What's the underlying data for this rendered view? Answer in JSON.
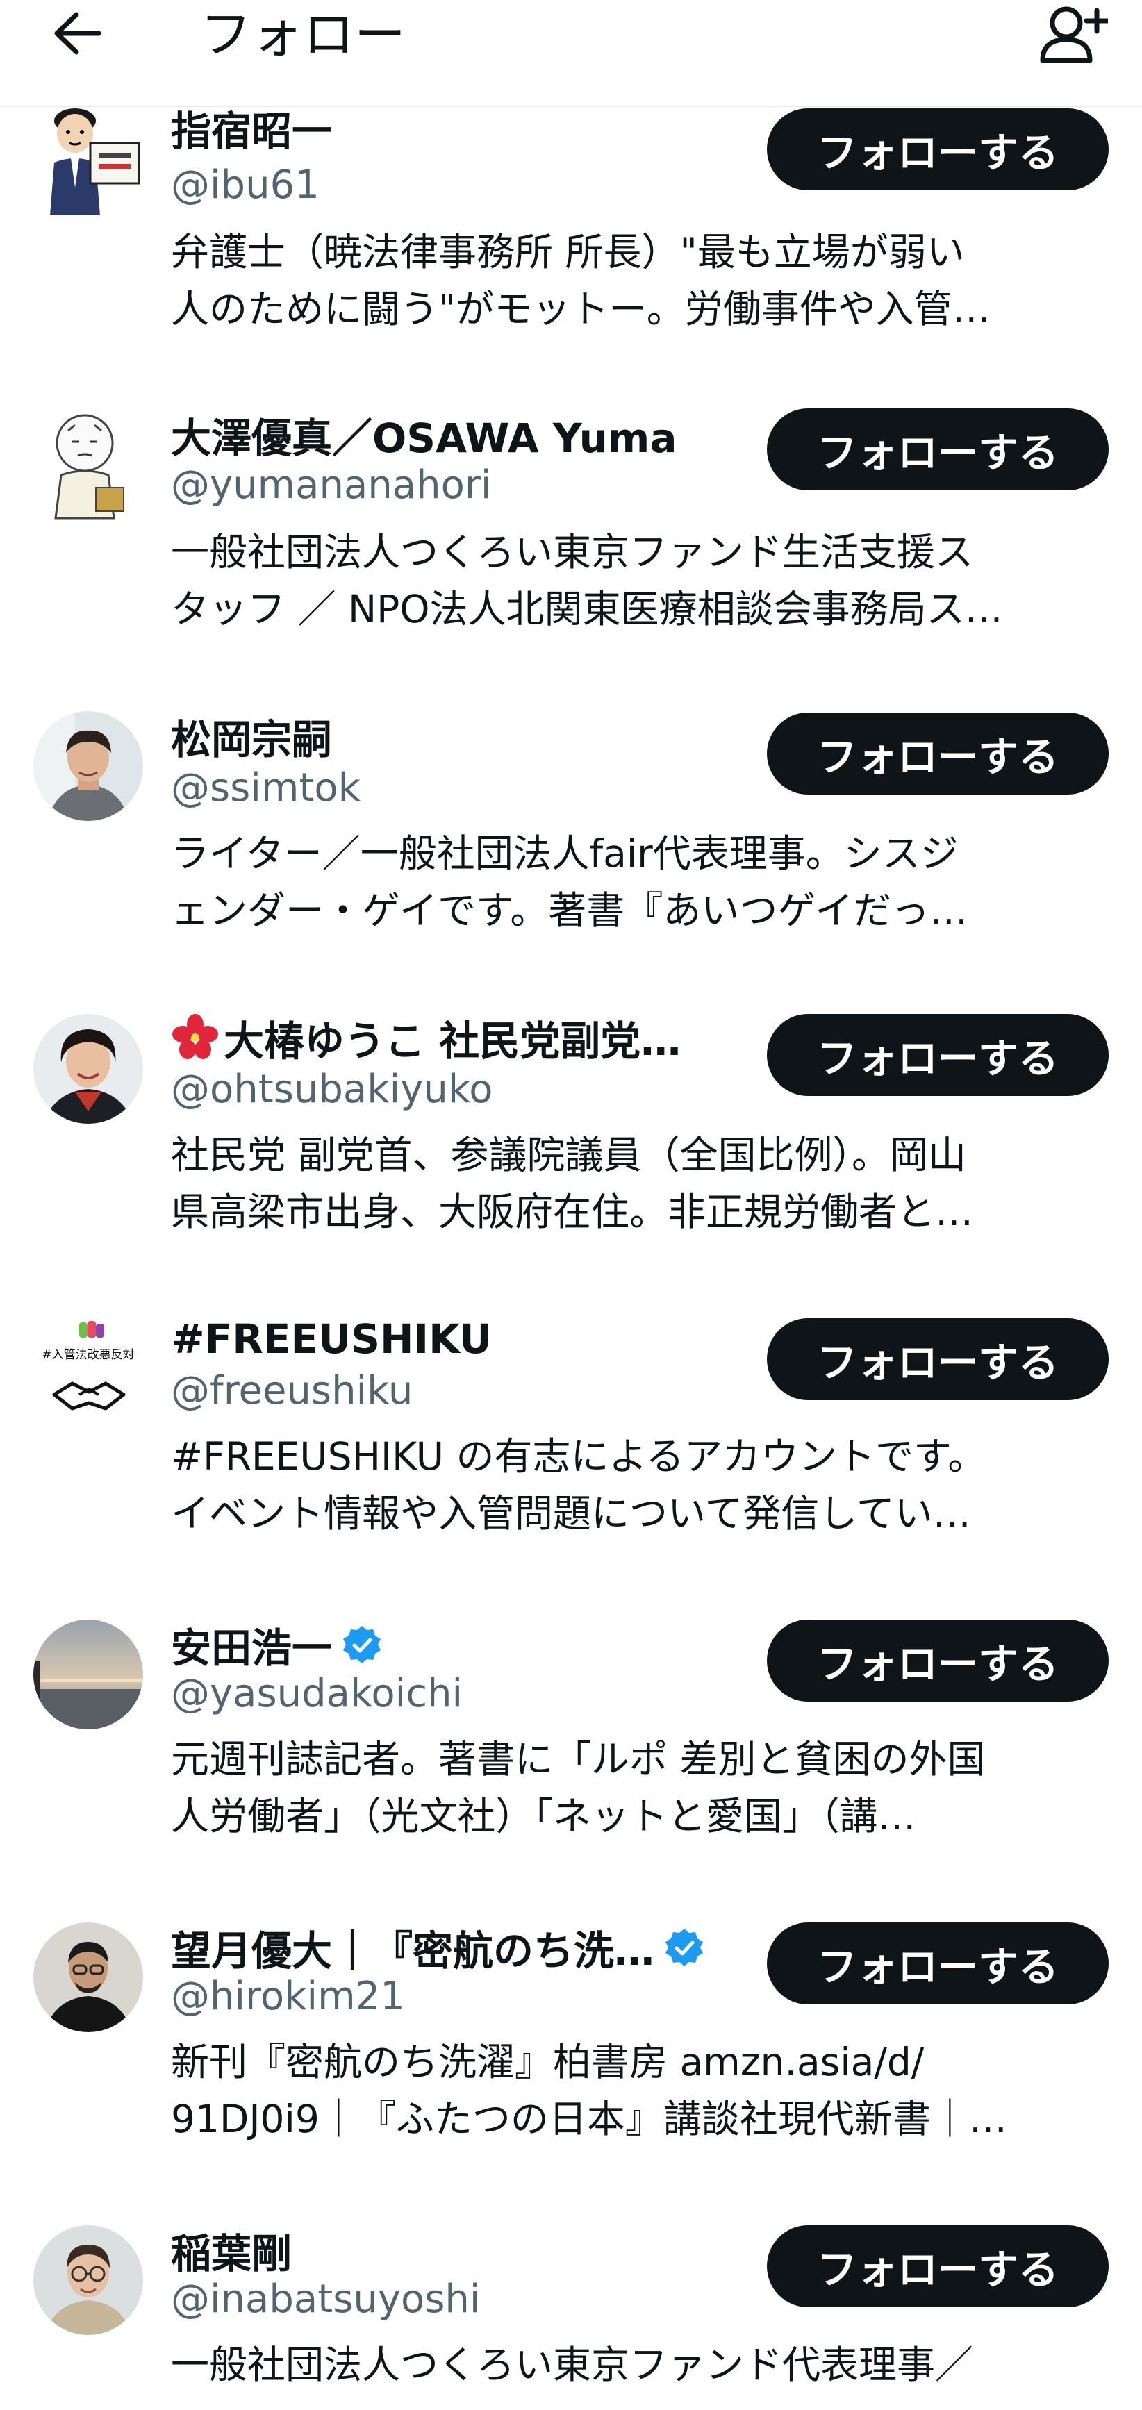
{
  "header": {
    "title": "フォロー",
    "back_icon": "arrow-left-icon",
    "add_user_icon": "person-plus-icon"
  },
  "colors": {
    "text": "#0f1419",
    "secondary_text": "#536471",
    "button_bg": "#0f1419",
    "button_text": "#ffffff",
    "verified": "#1d9bf0"
  },
  "users": [
    {
      "name": "指宿昭一",
      "handle": "@ibu61",
      "verified": false,
      "bio": [
        "弁護士（暁法律事務所 所長）\"最も立場が弱い",
        "人のために闘う\"がモットー。労働事件や入管…"
      ],
      "follow_label": "フォローする"
    },
    {
      "name": "大澤優真／OSAWA Yuma",
      "handle": "@yumananahori",
      "verified": false,
      "bio": [
        "一般社団法人つくろい東京ファンド生活支援ス",
        "タッフ ／ NPO法人北関東医療相談会事務局ス…"
      ],
      "follow_label": "フォローする"
    },
    {
      "name": "松岡宗嗣",
      "handle": "@ssimtok",
      "verified": false,
      "bio": [
        "ライター／一般社団法人fair代表理事。シスジ",
        "ェンダー・ゲイです。著書『あいつゲイだっ…"
      ],
      "follow_label": "フォローする"
    },
    {
      "name": "大椿ゆうこ 社民党副党…",
      "handle": "@ohtsubakiyuko",
      "verified": false,
      "bio": [
        "社民党 副党首、参議院議員（全国比例）。岡山",
        "県高梁市出身、大阪府在住。非正規労働者と…"
      ],
      "follow_label": "フォローする"
    },
    {
      "name": "#FREEUSHIKU",
      "handle": "@freeushiku",
      "verified": false,
      "bio": [
        "#FREEUSHIKU の有志によるアカウントです。",
        "イベント情報や入管問題について発信してい…"
      ],
      "follow_label": "フォローする"
    },
    {
      "name": "安田浩一",
      "handle": "@yasudakoichi",
      "verified": true,
      "bio": [
        "元週刊誌記者。著書に「ルポ 差別と貧困の外国",
        "人労働者」（光文社）「ネットと愛国」（講…"
      ],
      "follow_label": "フォローする"
    },
    {
      "name": "望月優大｜『密航のち洗…",
      "handle": "@hirokim21",
      "verified": true,
      "bio": [
        "新刊『密航のち洗濯』柏書房 amzn.asia/d/",
        "91DJ0i9｜『ふたつの日本』講談社現代新書｜…"
      ],
      "follow_label": "フォローする"
    },
    {
      "name": "稲葉剛",
      "handle": "@inabatsuyoshi",
      "verified": false,
      "bio": [
        "一般社団法人つくろい東京ファンド代表理事／"
      ],
      "follow_label": "フォローする"
    }
  ],
  "avatars": [
    {
      "icon": "cartoon-lawyer-avatar"
    },
    {
      "icon": "sketch-character-avatar"
    },
    {
      "icon": "man-photo-avatar"
    },
    {
      "icon": "woman-photo-avatar"
    },
    {
      "icon": "handshake-logo-avatar",
      "label": "#入管法改悪反対"
    },
    {
      "icon": "sunset-sea-avatar"
    },
    {
      "icon": "man-dark-photo-avatar"
    },
    {
      "icon": "man-glasses-photo-avatar"
    }
  ]
}
